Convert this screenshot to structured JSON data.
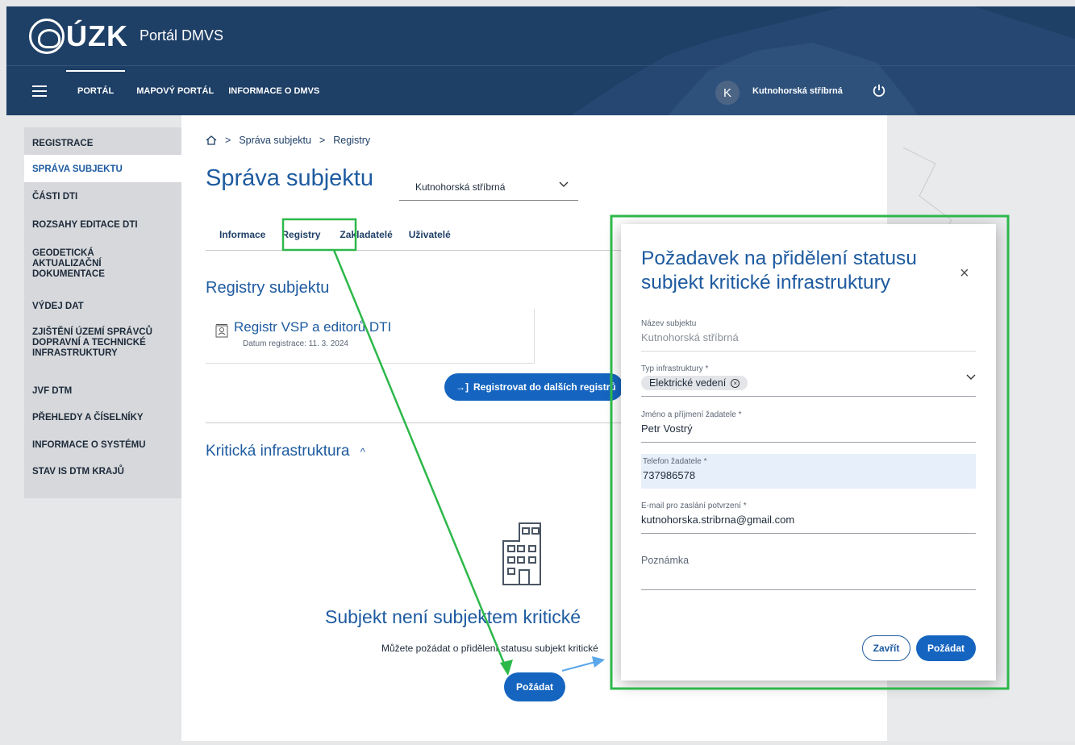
{
  "header": {
    "logo_text": "ÚZK",
    "portal_name": "Portál DMVS",
    "nav": [
      "PORTÁL",
      "MAPOVÝ PORTÁL",
      "INFORMACE O DMVS"
    ],
    "user_initial": "K",
    "user_name": "Kutnohorská stříbrná"
  },
  "sidebar": {
    "items": [
      "REGISTRACE",
      "SPRÁVA SUBJEKTU",
      "ČÁSTI DTI",
      "ROZSAHY EDITACE DTI",
      "GEODETICKÁ\nAKTUALIZAČNÍ\nDOKUMENTACE",
      "VÝDEJ DAT",
      "ZJIŠTĚNÍ ÚZEMÍ SPRÁVCŮ\nDOPRAVNÍ A TECHNICKÉ\nINFRASTRUKTURY",
      "JVF DTM",
      "PŘEHLEDY A ČÍSELNÍKY",
      "INFORMACE O SYSTÉMU",
      "STAV IS DTM KRAJŮ"
    ],
    "active_index": 1
  },
  "main": {
    "breadcrumb": [
      "Správa subjektu",
      "Registry"
    ],
    "title": "Správa subjektu",
    "subject_select": "Kutnohorská stříbrná",
    "tabs": [
      "Informace",
      "Registry",
      "Zakladatelé",
      "Uživatelé"
    ],
    "registry_section_title": "Registry subjektu",
    "registry_card": {
      "title": "Registr VSP a editorů DTI",
      "date": "Datum registrace: 11. 3. 2024"
    },
    "register_button": "Registrovat do dalších registrů",
    "critical_section_title": "Kritická infrastruktura",
    "empty_title": "Subjekt není subjektem kritické",
    "empty_text": "Můžete požádat o přidělení statusu subjekt kritické",
    "request_button": "Požádat"
  },
  "modal": {
    "title": "Požadavek na přidělení statusu subjekt kritické infrastruktury",
    "fields": {
      "subject_name": {
        "label": "Název subjektu",
        "value": "Kutnohorská stříbrná"
      },
      "infra_type": {
        "label": "Typ infrastruktury *",
        "value": "Elektrické vedení"
      },
      "applicant_name": {
        "label": "Jméno a příjmení žadatele *",
        "value": "Petr Vostrý"
      },
      "applicant_phone": {
        "label": "Telefon žadatele *",
        "value": "737986578"
      },
      "email": {
        "label": "E-mail pro zaslání potvrzení *",
        "value": "kutnohorska.stribrna@gmail.com"
      },
      "note": {
        "label": "Poznámka",
        "value": ""
      }
    },
    "close_button": "Zavřít",
    "submit_button": "Požádat"
  },
  "colors": {
    "header_bg": "#1e3f66",
    "accent": "#1565c0",
    "annotation": "#2db84a"
  }
}
